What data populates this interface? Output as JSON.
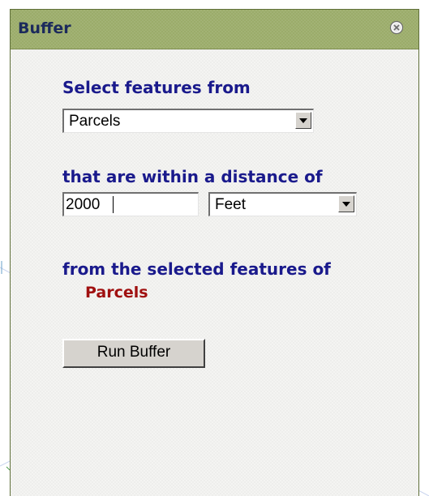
{
  "window": {
    "title": "Buffer",
    "close_icon": "close-circle-icon"
  },
  "form": {
    "select_label": "Select features from",
    "source_layer": "Parcels",
    "distance_label": "that are within a distance of",
    "distance_value": "2000",
    "distance_unit": "Feet",
    "from_label": "from the selected features of",
    "selected_layer": "Parcels",
    "run_button": "Run Buffer"
  },
  "colors": {
    "titlebar": "#9bac6a",
    "label_text": "#1a1a8c",
    "layer_text": "#a01010"
  }
}
